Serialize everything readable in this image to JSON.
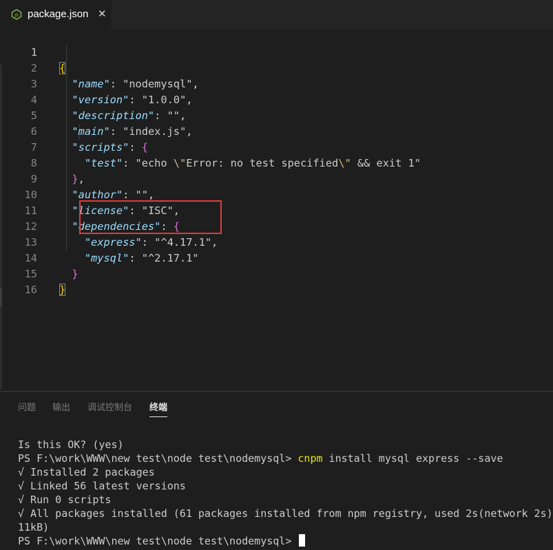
{
  "tab": {
    "icon": "nodejs-icon",
    "label": "package.json",
    "close": "✕"
  },
  "editor": {
    "line_numbers": [
      "1",
      "2",
      "3",
      "4",
      "5",
      "6",
      "7",
      "8",
      "9",
      "10",
      "11",
      "12",
      "13",
      "14",
      "15",
      "16"
    ],
    "lines": {
      "l1_open": "{",
      "l2_key": "\"name\"",
      "l2_val": "\"nodemysql\"",
      "l3_key": "\"version\"",
      "l3_val": "\"1.0.0\"",
      "l4_key": "\"description\"",
      "l4_val": "\"\"",
      "l5_key": "\"main\"",
      "l5_val": "\"index.js\"",
      "l6_key": "\"scripts\"",
      "l6_open": "{",
      "l7_key": "\"test\"",
      "l7_val_a": "\"echo ",
      "l7_esc1": "\\\"",
      "l7_val_b": "Error: no test specified",
      "l7_esc2": "\\\"",
      "l7_val_c": " && exit 1\"",
      "l8_close": "}",
      "l9_key": "\"author\"",
      "l9_val": "\"\"",
      "l10_key": "\"license\"",
      "l10_val": "\"ISC\"",
      "l11_key": "\"dependencies\"",
      "l11_open": "{",
      "l12_key": "\"express\"",
      "l12_val": "\"^4.17.1\"",
      "l13_key": "\"mysql\"",
      "l13_val": "\"^2.17.1\"",
      "l14_close": "}",
      "l15_close": "}"
    }
  },
  "panel": {
    "tabs": [
      "问题",
      "输出",
      "调试控制台",
      "终端"
    ],
    "active_tab": "终端",
    "terminal": {
      "line1": "Is this OK? (yes)",
      "line2_prompt": "PS F:\\work\\WWW\\new test\\node test\\nodemysql> ",
      "line2_cmd": "cnpm",
      "line2_args": " install mysql express --save",
      "line3": "√ Installed 2 packages",
      "line4": "√ Linked 56 latest versions",
      "line5": "√ Run 0 scripts",
      "line6": "√ All packages installed (61 packages installed from npm registry, used 2s(network 2s),",
      "line7": "11kB)",
      "line8_prompt": "PS F:\\work\\WWW\\new test\\node test\\nodemysql> "
    }
  },
  "colors": {
    "background": "#1e1e1e",
    "key": "#9cdcfe",
    "string": "#ce9178",
    "highlight_box": "#e03c3c",
    "terminal_command": "#e5e510"
  }
}
